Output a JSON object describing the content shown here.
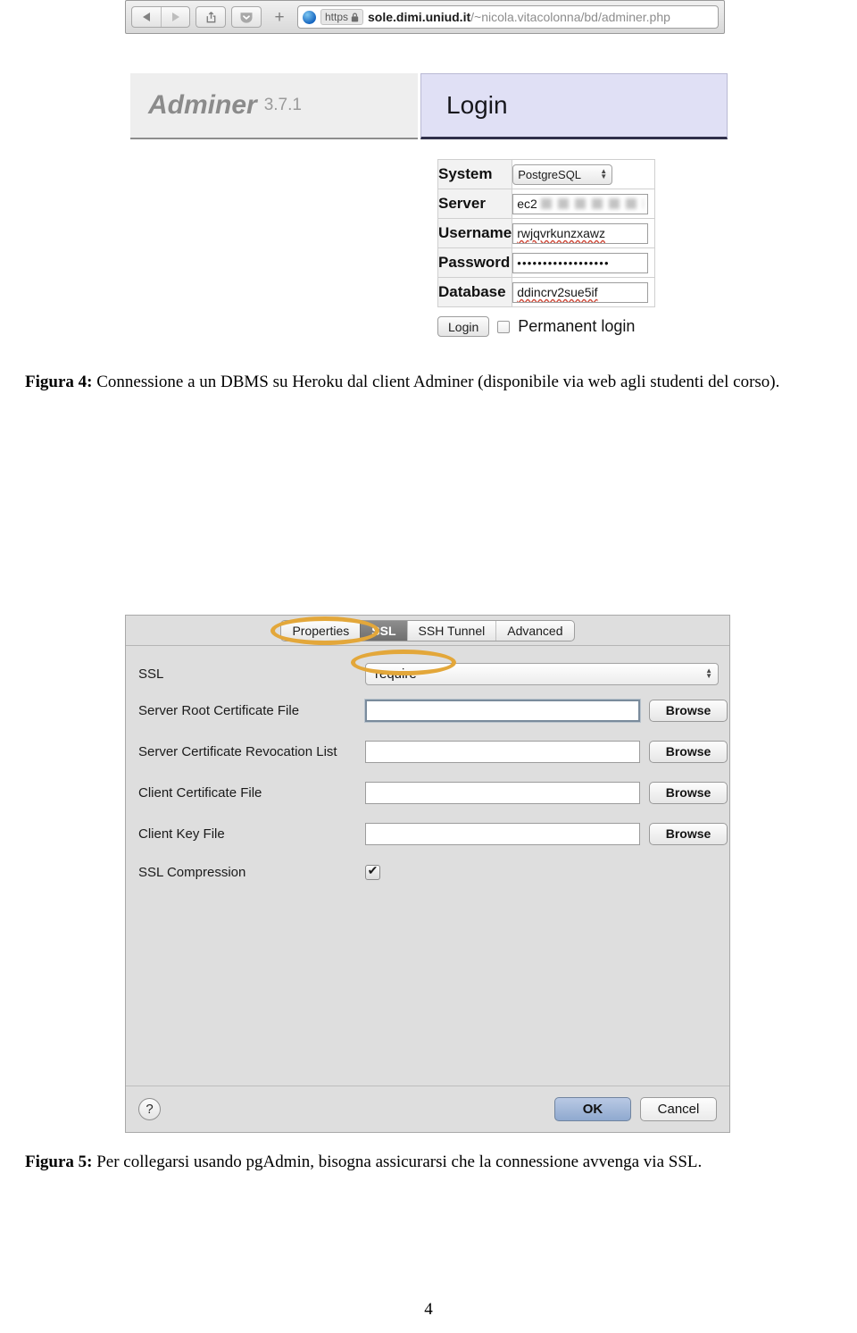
{
  "page": {
    "number": "4"
  },
  "figure4": {
    "browser": {
      "back_icon": "back-arrow",
      "forward_icon": "forward-arrow",
      "share_icon": "share",
      "pocket_icon": "pocket-shield",
      "new_tab_icon": "+",
      "scheme_label": "https",
      "lock_glyph": "⌂",
      "url_host": "sole.dimi.uniud.it",
      "url_path": "/~nicola.vitacolonna/bd/adminer.php"
    },
    "adminer": {
      "brand_name": "Adminer",
      "brand_version": "3.7.1",
      "tab_label": "Login",
      "fields": [
        {
          "label": "System",
          "type": "select",
          "value": "PostgreSQL"
        },
        {
          "label": "Server",
          "type": "redacted",
          "value": "ec2"
        },
        {
          "label": "Username",
          "type": "text",
          "value": "rwjqvrkunzxawz"
        },
        {
          "label": "Password",
          "type": "password",
          "value": "••••••••••••••••••"
        },
        {
          "label": "Database",
          "type": "text",
          "value": "ddincrv2sue5if"
        }
      ],
      "login_button": "Login",
      "permanent_login_label": "Permanent login",
      "permanent_login_checked": false
    },
    "caption_prefix": "Figura 4:",
    "caption_text": "Connessione a un DBMS su Heroku dal client Adminer (disponibile via web agli studenti del corso)."
  },
  "figure5": {
    "dialog": {
      "tabs": [
        {
          "label": "Properties",
          "selected": false
        },
        {
          "label": "SSL",
          "selected": true
        },
        {
          "label": "SSH Tunnel",
          "selected": false
        },
        {
          "label": "Advanced",
          "selected": false
        }
      ],
      "ssl_row": {
        "label": "SSL",
        "value": "require"
      },
      "rows": [
        {
          "label": "Server Root Certificate File",
          "value": "",
          "button": "Browse",
          "focused": true
        },
        {
          "label": "Server Certificate Revocation List",
          "value": "",
          "button": "Browse",
          "focused": false
        },
        {
          "label": "Client Certificate File",
          "value": "",
          "button": "Browse",
          "focused": false
        },
        {
          "label": "Client Key File",
          "value": "",
          "button": "Browse",
          "focused": false
        }
      ],
      "compression": {
        "label": "SSL Compression",
        "checked": true,
        "check_glyph": "✔"
      },
      "help_label": "?",
      "ok_label": "OK",
      "cancel_label": "Cancel",
      "highlight_color": "#e3a73a"
    },
    "caption_prefix": "Figura 5:",
    "caption_text": "Per collegarsi usando pgAdmin, bisogna assicurarsi che la connessione avvenga via SSL."
  }
}
